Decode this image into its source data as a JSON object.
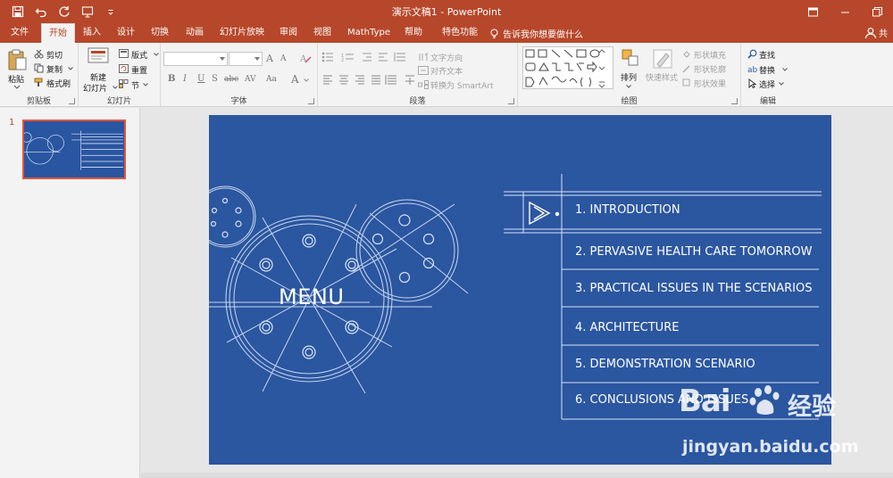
{
  "app": {
    "title": "演示文稿1 - PowerPoint",
    "brand_color": "#b7472a"
  },
  "tabs": [
    {
      "label": "文件"
    },
    {
      "label": "开始"
    },
    {
      "label": "插入"
    },
    {
      "label": "设计"
    },
    {
      "label": "切换"
    },
    {
      "label": "动画"
    },
    {
      "label": "幻灯片放映"
    },
    {
      "label": "审阅"
    },
    {
      "label": "视图"
    },
    {
      "label": "MathType"
    },
    {
      "label": "帮助"
    },
    {
      "label": "特色功能"
    }
  ],
  "tell_me": "告诉我你想要做什么",
  "share_label": "共",
  "ribbon": {
    "clipboard": {
      "paste": "粘贴",
      "cut": "剪切",
      "copy": "复制",
      "format_painter": "格式刷",
      "label": "剪贴板"
    },
    "slides": {
      "new_slide_line1": "新建",
      "new_slide_line2": "幻灯片",
      "layout": "版式",
      "reset": "重置",
      "section": "节",
      "label": "幻灯片"
    },
    "font": {
      "bold": "B",
      "italic": "I",
      "underline": "U",
      "shadow": "S",
      "strike": "abc",
      "spacing": "AV",
      "case": "Aa",
      "color": "A",
      "grow": "A",
      "shrink": "A",
      "label": "字体"
    },
    "paragraph": {
      "text_direction": "文字方向",
      "align_text": "对齐文本",
      "smartart": "转换为 SmartArt",
      "label": "段落"
    },
    "drawing": {
      "arrange": "排列",
      "quick_styles": "快速样式",
      "shape_fill": "形状填充",
      "shape_outline": "形状轮廓",
      "shape_effects": "形状效果",
      "label": "绘图"
    },
    "editing": {
      "find": "查找",
      "replace": "替换",
      "select": "选择",
      "label": "编辑"
    }
  },
  "thumbnail": {
    "number": "1"
  },
  "slide": {
    "title": "MENU",
    "bg_color": "#2b56a0",
    "items": [
      "1. INTRODUCTION",
      "2. PERVASIVE HEALTH CARE TOMORROW",
      "3. PRACTICAL ISSUES IN THE SCENARIOS",
      "4. ARCHITECTURE",
      "5. DEMONSTRATION SCENARIO",
      "6. CONCLUSIONS AND ISSUES"
    ]
  },
  "watermark": {
    "brand": "Bai",
    "brand_cn": "经验",
    "url": "jingyan.baidu.com"
  }
}
